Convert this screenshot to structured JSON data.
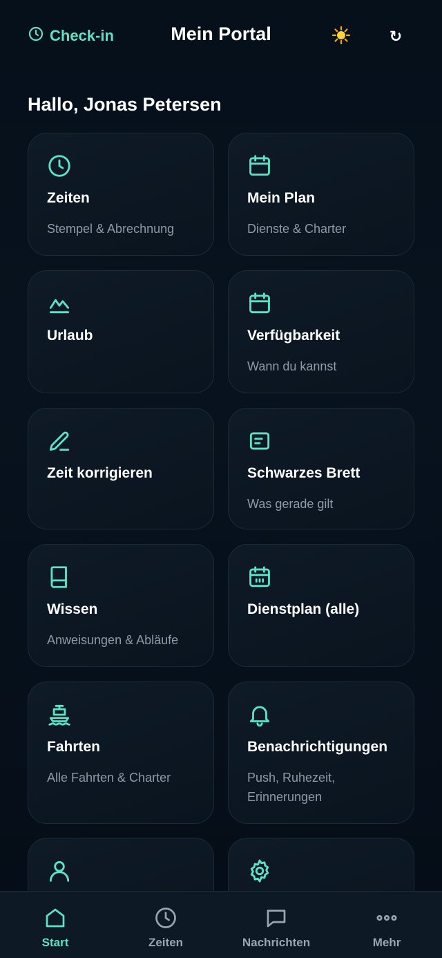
{
  "header": {
    "checkin_label": "Check-in",
    "title": "Mein Portal",
    "sun_icon": "sun-icon",
    "refresh_icon": "↻"
  },
  "greeting": "Hallo, Jonas Petersen",
  "accent_color": "#5ee2c4",
  "cards": [
    {
      "icon": "clock-icon",
      "title": "Zeiten",
      "subtitle": "Stempel & Abrechnung"
    },
    {
      "icon": "calendar-icon",
      "title": "Mein Plan",
      "subtitle": "Dienste & Charter"
    },
    {
      "icon": "mountain-icon",
      "title": "Urlaub",
      "subtitle": ""
    },
    {
      "icon": "calendar-icon",
      "title": "Verfügbarkeit",
      "subtitle": "Wann du kannst"
    },
    {
      "icon": "pencil-icon",
      "title": "Zeit korrigieren",
      "subtitle": ""
    },
    {
      "icon": "note-icon",
      "title": "Schwarzes Brett",
      "subtitle": "Was gerade gilt"
    },
    {
      "icon": "book-icon",
      "title": "Wissen",
      "subtitle": "Anweisungen & Abläufe"
    },
    {
      "icon": "calendar-grid-icon",
      "title": "Dienstplan (alle)",
      "subtitle": ""
    },
    {
      "icon": "ship-icon",
      "title": "Fahrten",
      "subtitle": "Alle Fahrten & Charter"
    },
    {
      "icon": "bell-icon",
      "title": "Benachrichtigungen",
      "subtitle": "Push, Ruhezeit, Erinnerungen"
    },
    {
      "icon": "user-icon",
      "title": "",
      "subtitle": ""
    },
    {
      "icon": "gear-icon",
      "title": "",
      "subtitle": ""
    }
  ],
  "bottom_nav": [
    {
      "icon": "home-icon",
      "label": "Start",
      "active": true
    },
    {
      "icon": "clock-icon",
      "label": "Zeiten",
      "active": false
    },
    {
      "icon": "chat-icon",
      "label": "Nachrichten",
      "active": false
    },
    {
      "icon": "more-icon",
      "label": "Mehr",
      "active": false
    }
  ]
}
